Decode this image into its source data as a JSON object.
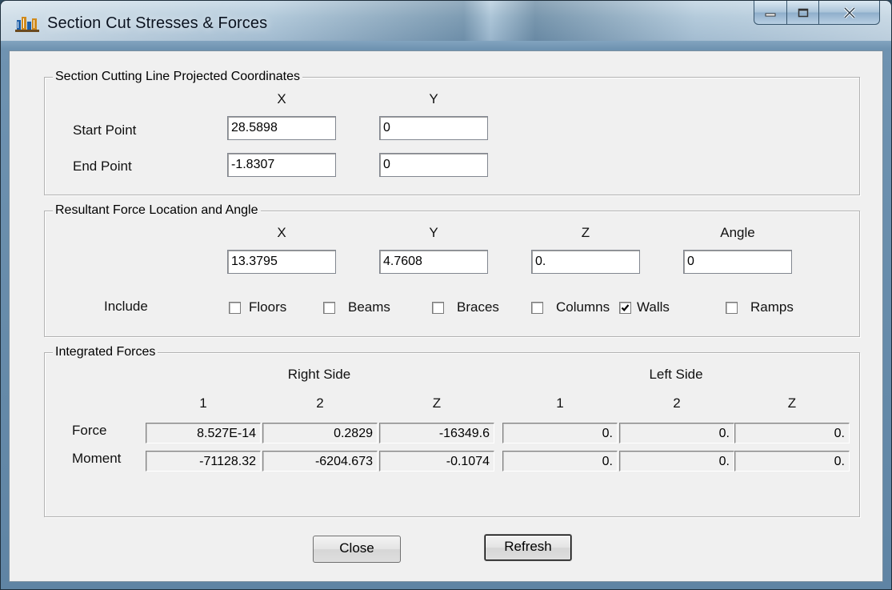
{
  "window": {
    "title": "Section Cut Stresses & Forces",
    "app_icon": "building-icon",
    "controls": [
      "minimize-icon",
      "maximize-icon",
      "close-icon"
    ]
  },
  "section_line": {
    "legend": "Section Cutting Line Projected Coordinates",
    "x_header": "X",
    "y_header": "Y",
    "start_label": "Start Point",
    "end_label": "End Point",
    "start_x": "28.5898",
    "start_y": "0",
    "end_x": "-1.8307",
    "end_y": "0"
  },
  "resultant": {
    "legend": "Resultant Force Location and Angle",
    "x_header": "X",
    "y_header": "Y",
    "z_header": "Z",
    "angle_header": "Angle",
    "x": "13.3795",
    "y": "4.7608",
    "z": "0.",
    "angle": "0",
    "include_label": "Include",
    "include": {
      "floors": {
        "label": "Floors",
        "checked": false
      },
      "beams": {
        "label": "Beams",
        "checked": false
      },
      "braces": {
        "label": "Braces",
        "checked": false
      },
      "columns": {
        "label": "Columns",
        "checked": false
      },
      "walls": {
        "label": "Walls",
        "checked": true
      },
      "ramps": {
        "label": "Ramps",
        "checked": false
      }
    }
  },
  "integrated": {
    "legend": "Integrated Forces",
    "right_side": "Right Side",
    "left_side": "Left Side",
    "col_1": "1",
    "col_2": "2",
    "col_z": "Z",
    "force_label": "Force",
    "moment_label": "Moment",
    "right_force": [
      "8.527E-14",
      "0.2829",
      "-16349.6"
    ],
    "right_moment": [
      "-71128.32",
      "-6204.673",
      "-0.1074"
    ],
    "left_force": [
      "0.",
      "0.",
      "0."
    ],
    "left_moment": [
      "0.",
      "0.",
      "0."
    ]
  },
  "buttons": {
    "close": "Close",
    "refresh": "Refresh"
  }
}
